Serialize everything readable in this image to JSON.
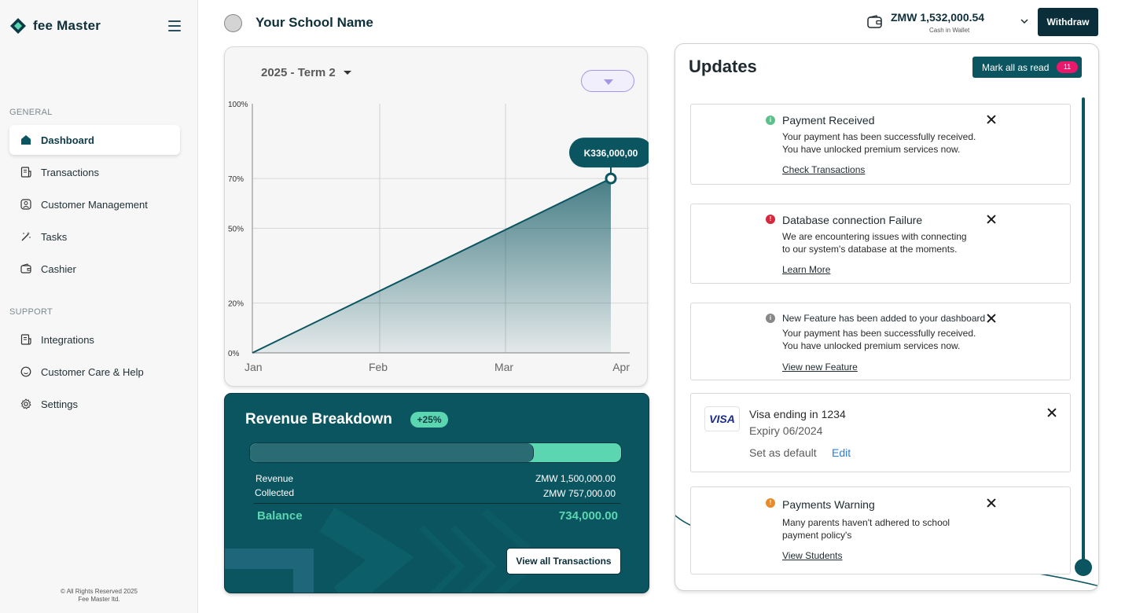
{
  "brand": {
    "name": "fee Master"
  },
  "sidebar": {
    "sections": {
      "general": "GENERAL",
      "support": "SUPPORT"
    },
    "items": [
      {
        "label": "Dashboard",
        "icon": "home-icon",
        "active": true
      },
      {
        "label": "Transactions",
        "icon": "receipt-icon"
      },
      {
        "label": "Customer Management",
        "icon": "user-icon"
      },
      {
        "label": "Tasks",
        "icon": "magic-wand-icon"
      },
      {
        "label": "Cashier",
        "icon": "wallet-icon"
      },
      {
        "label": "Integrations",
        "icon": "receipt-icon"
      },
      {
        "label": "Customer Care & Help",
        "icon": "chat-icon"
      },
      {
        "label": "Settings",
        "icon": "gear-icon"
      }
    ],
    "footer_line1": "© All Rights Reserved 2025",
    "footer_line2": "Fee Master ltd."
  },
  "header": {
    "school_name": "Your School Name",
    "wallet_amount": "ZMW 1,532,000.54",
    "wallet_label": "Cash in Wallet",
    "withdraw_label": "Withdraw"
  },
  "chart": {
    "term": "2025 - Term 2",
    "tooltip": "K336,000,00"
  },
  "chart_data": {
    "type": "area",
    "x": [
      "Jan",
      "Feb",
      "Mar",
      "Apr"
    ],
    "y_ticks": [
      "100%",
      "70%",
      "50%",
      "20%",
      "0%"
    ],
    "series": [
      {
        "points": [
          [
            0,
            0
          ],
          [
            2.85,
            70
          ]
        ]
      }
    ],
    "highlight": {
      "x": 2.85,
      "y": 70,
      "label": "K336,000,00"
    },
    "ylim": [
      0,
      100
    ],
    "grid": true,
    "colors": {
      "line": "#0b5560",
      "area": "#0b5560"
    }
  },
  "revenue": {
    "title": "Revenue Breakdown",
    "badge": "+25%",
    "collected_fraction": 0.765,
    "revenue_label": "Revenue",
    "revenue_value": "ZMW 1,500,000.00",
    "collected_label": "Collected",
    "collected_value": "ZMW 757,000.00",
    "balance_label": "Balance",
    "balance_value": "734,000.00",
    "view_all_label": "View all Transactions"
  },
  "updates": {
    "title": "Updates",
    "mark_all_label": "Mark all as read",
    "unread_count": "11",
    "notifications": [
      {
        "status_color": "#5cc08a",
        "title": "Payment Received",
        "body1": "Your payment has been successfully received.",
        "body2": "You have unlocked premium services now.",
        "link": "Check Transactions"
      },
      {
        "status_color": "#d6283a",
        "title": "Database connection Failure",
        "body1": "We are encountering issues with connecting",
        "body2": "to our system's database at the moments.",
        "link": "Learn More"
      },
      {
        "status_color": "#888888",
        "title": "New Feature has been added to your dashboard",
        "body1": "Your payment has been successfully received.",
        "body2": "You have unlocked premium services now.",
        "link": "View new Feature"
      },
      {
        "status_color": "#e88a2a",
        "title": "Payments Warning",
        "body1": "Many parents haven't adhered to school",
        "body2": "payment policy's",
        "link": "View Students"
      }
    ],
    "card": {
      "brand": "VISA",
      "title": "Visa ending in 1234",
      "expiry": "Expiry 06/2024",
      "set_default": "Set as default",
      "edit": "Edit"
    }
  }
}
